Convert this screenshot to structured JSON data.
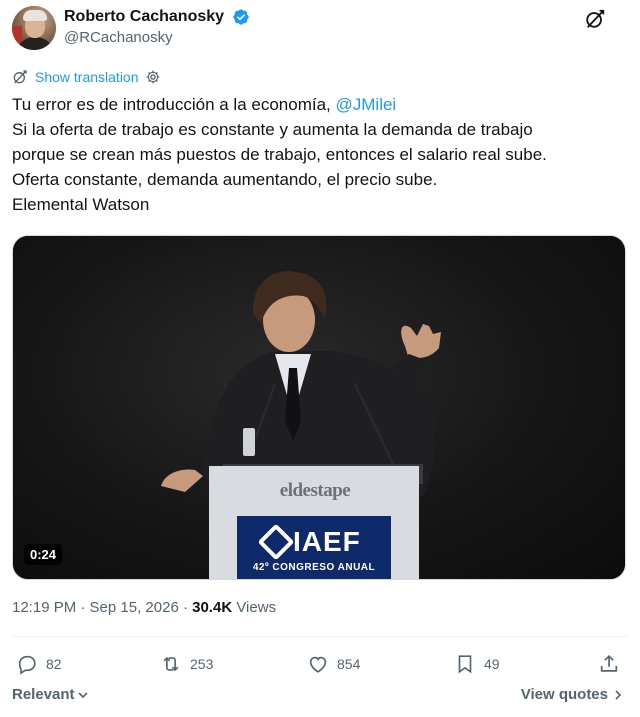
{
  "author": {
    "display_name": "Roberto Cachanosky",
    "handle": "@RCachanosky",
    "verified": true
  },
  "translate": {
    "label": "Show translation"
  },
  "tweet": {
    "lines": [
      "Tu error es de introducción a la economía,",
      "Si la oferta de trabajo es constante y aumenta la demanda de trabajo",
      "porque se crean más puestos de trabajo, entonces el salario real sube.",
      "Oferta constante, demanda aumentando, el precio sube.",
      "Elemental Watson"
    ],
    "mention": "@JMilei"
  },
  "media": {
    "duration": "0:24",
    "podium_text": "eldestape",
    "banner_title": "IAEF",
    "banner_subtitle": "42º CONGRESO ANUAL"
  },
  "meta": {
    "timestamp": "12:19 PM · Sep 15, 2026 · ",
    "views_count": "30.4K",
    "views_label": " Views"
  },
  "actions": {
    "replies": "82",
    "reposts": "253",
    "likes": "854",
    "bookmarks": "49"
  },
  "footer": {
    "sort_label": "Relevant",
    "view_quotes_label": "View quotes"
  },
  "colors": {
    "accent": "#1d9bf0",
    "secondary_text": "#536471",
    "primary_text": "#0f1419"
  },
  "icons": {
    "verified": "verified-badge-icon",
    "grok": "grok-icon",
    "translate": "translate-icon",
    "settings": "gear-icon",
    "reply": "reply-icon",
    "repost": "repost-icon",
    "like": "heart-icon",
    "bookmark": "bookmark-icon",
    "share": "share-icon"
  }
}
